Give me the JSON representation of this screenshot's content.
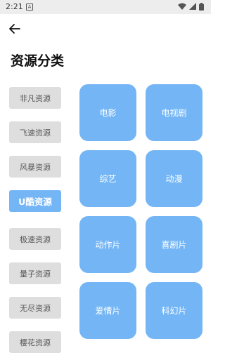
{
  "status": {
    "time": "2:21",
    "notif_letter": "A"
  },
  "header": {
    "title": "资源分类"
  },
  "sources": [
    {
      "label": "非凡资源",
      "active": false
    },
    {
      "label": "飞速资源",
      "active": false
    },
    {
      "label": "风暴资源",
      "active": false
    },
    {
      "label": "U酷资源",
      "active": true
    },
    {
      "label": "极速资源",
      "active": false
    },
    {
      "label": "量子资源",
      "active": false
    },
    {
      "label": "无尽资源",
      "active": false
    },
    {
      "label": "樱花资源",
      "active": false
    }
  ],
  "genres": [
    "电影",
    "电视剧",
    "综艺",
    "动漫",
    "动作片",
    "喜剧片",
    "爱情片",
    "科幻片"
  ],
  "colors": {
    "accent": "#74b6f5",
    "inactive": "#dedede"
  }
}
